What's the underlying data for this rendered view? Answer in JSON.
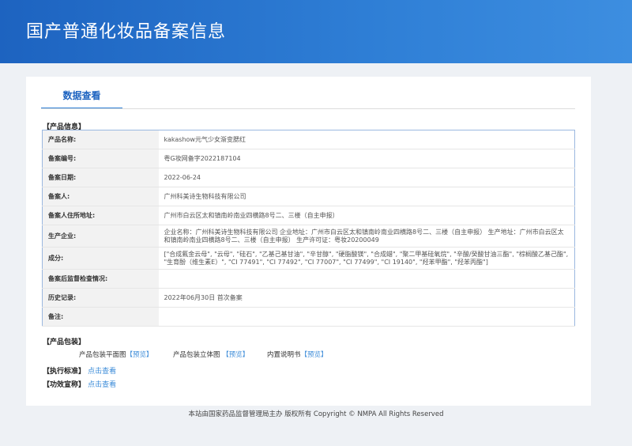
{
  "header": {
    "title": "国产普通化妆品备案信息"
  },
  "tab": "数据查看",
  "sections": {
    "product_info": "【产品信息】",
    "packaging": "【产品包装】",
    "standard": "【执行标准】",
    "efficacy": "【功效宣称】"
  },
  "rows": [
    {
      "label": "产品名称:",
      "value": "kakashow元气少女渐变腮红"
    },
    {
      "label": "备案编号:",
      "value": "粤G妆网备字2022187104"
    },
    {
      "label": "备案日期:",
      "value": "2022-06-24"
    },
    {
      "label": "备案人:",
      "value": "广州科美诗生物科技有限公司"
    },
    {
      "label": "备案人住所地址:",
      "value": "广州市白云区太和镇南岭南业四横路8号二、三楼（自主申报）"
    },
    {
      "label": "生产企业:",
      "value": "企业名称：广州科美诗生物科技有限公司 企业地址：广州市白云区太和镇南岭南业四横路8号二、三楼（自主申报） 生产地址：广州市白云区太和镇南岭南业四横路8号二、三楼（自主申报） 生产许可证：粤妆20200049"
    },
    {
      "label": "成分:",
      "value": "[\"合成氟金云母\", \"云母\", \"硅石\", \"乙基己基甘油\", \"辛甘醇\", \"硬脂酸镁\", \"合成蜡\", \"聚二甲基硅氧烷\", \"辛酸/癸酸甘油三酯\", \"棕榈酸乙基己酯\", \"生育酚（维生素E）\", \"CI 77491\", \"CI 77492\", \"CI 77007\", \"CI 77499\", \"CI 19140\", \"羟苯甲酯\", \"羟苯丙酯\"]"
    },
    {
      "label": "备案后监督检查情况:",
      "value": ""
    },
    {
      "label": "历史记录:",
      "value": "2022年06月30日 首次备案"
    },
    {
      "label": "备注:",
      "value": ""
    }
  ],
  "packaging": [
    {
      "label": "产品包装平面图",
      "link": "【预览】"
    },
    {
      "label": "产品包装立体图",
      "link": "【预览】"
    },
    {
      "label": "内置说明书",
      "link": "【预览】"
    }
  ],
  "view_link": "点击查看",
  "footer": "本站由国家药品监督管理局主办 版权所有 Copyright © NMPA All Rights Reserved"
}
